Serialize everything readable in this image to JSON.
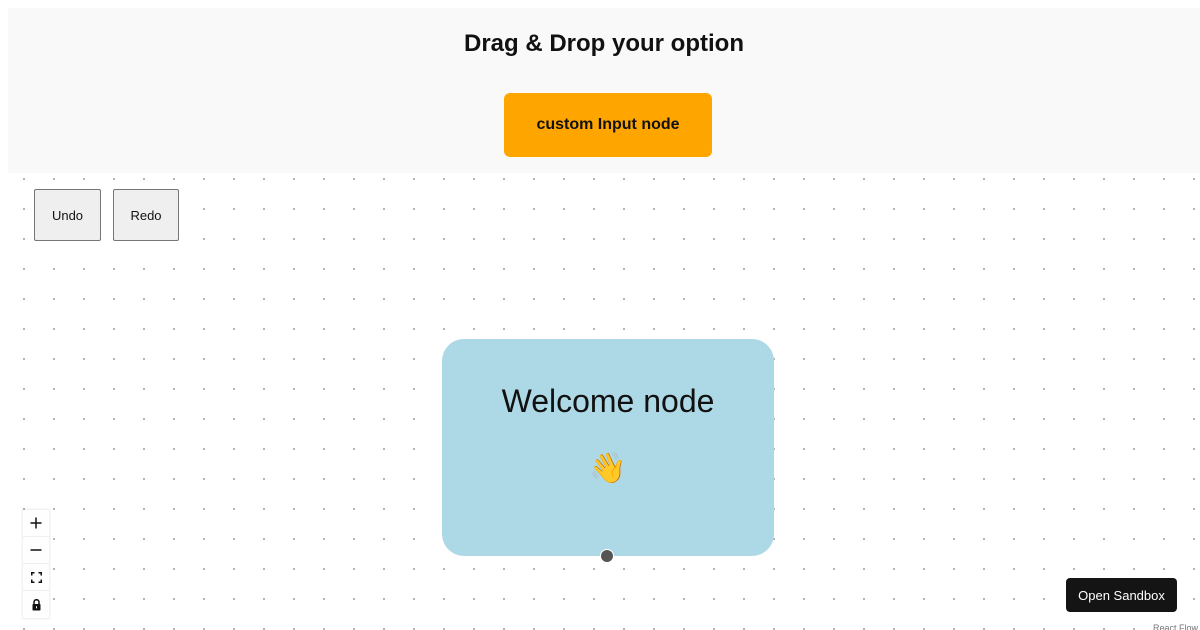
{
  "header": {
    "title": "Drag & Drop your option",
    "draggable_node_label": "custom Input node"
  },
  "toolbar": {
    "undo_label": "Undo",
    "redo_label": "Redo"
  },
  "canvas": {
    "welcome_node": {
      "title": "Welcome node",
      "emoji": "👋"
    },
    "controls": [
      {
        "name": "zoom-in-icon"
      },
      {
        "name": "zoom-out-icon"
      },
      {
        "name": "fit-view-icon"
      },
      {
        "name": "lock-icon"
      }
    ],
    "sandbox_label": "Open Sandbox",
    "attribution": "React Flow"
  },
  "colors": {
    "panel_bg": "#f9f9f9",
    "drag_node_bg": "#ffa500",
    "welcome_node_bg": "#add8e6",
    "handle": "#555555",
    "sandbox_bg": "#141414"
  }
}
